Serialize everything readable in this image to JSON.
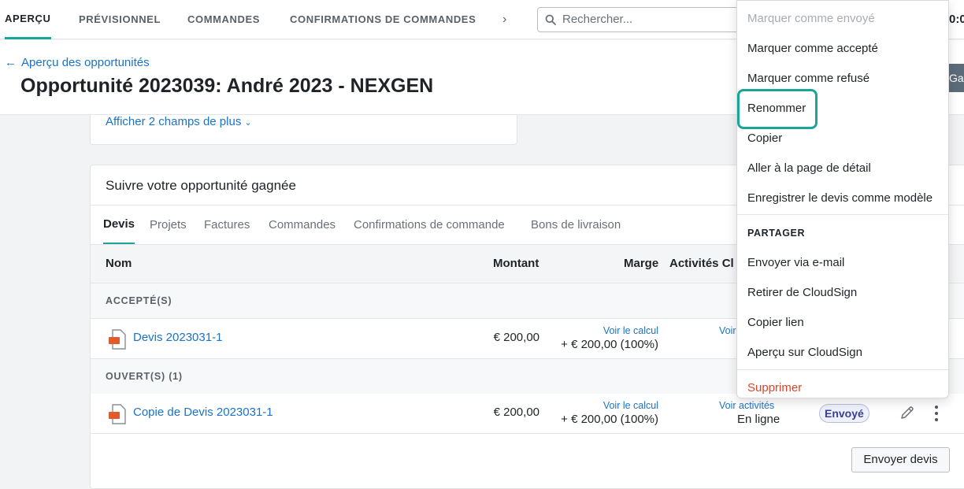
{
  "nav": {
    "tabs": [
      "APERÇU",
      "PRÉVISIONNEL",
      "COMMANDES",
      "CONFIRMATIONS DE COMMANDES"
    ],
    "more_chevron": "›",
    "search_placeholder": "Rechercher...",
    "clock_fragment": "0:0",
    "accent_color": "#1aa59a"
  },
  "header": {
    "back_link": "Aperçu des opportunités",
    "title": "Opportunité 2023039: André 2023 - NEXGEN",
    "right_button": "Ga"
  },
  "details_card": {
    "more_link": "Afficher 2 champs de plus"
  },
  "won_card": {
    "title": "Suivre votre opportunité gagnée",
    "tabs": [
      "Devis",
      "Projets",
      "Factures",
      "Commandes",
      "Confirmations de commande",
      "Bons de livraison"
    ],
    "columns": [
      "Nom",
      "Montant",
      "Marge",
      "Activités Cl"
    ],
    "groups": [
      {
        "label": "ACCEPTÉ(S)",
        "rows": [
          {
            "name": "Devis 2023031-1",
            "amount": "€ 200,00",
            "calc_link": "Voir le calcul",
            "margin": "+ € 200,00 (100%)",
            "activities_link": "Voir",
            "online": "",
            "status": ""
          }
        ]
      },
      {
        "label": "OUVERT(S) (1)",
        "rows": [
          {
            "name": "Copie de Devis 2023031-1",
            "amount": "€ 200,00",
            "calc_link": "Voir le calcul",
            "margin": "+ € 200,00 (100%)",
            "activities_link": "Voir activités",
            "online": "En ligne",
            "status": "Envoyé"
          }
        ]
      }
    ],
    "send_button": "Envoyer devis"
  },
  "menu": {
    "items": [
      {
        "label": "Marquer comme envoyé",
        "state": "disabled"
      },
      {
        "label": "Marquer comme accepté",
        "state": "normal"
      },
      {
        "label": "Marquer comme refusé",
        "state": "normal"
      },
      {
        "label": "Renommer",
        "state": "highlighted"
      },
      {
        "label": "Copier",
        "state": "normal"
      },
      {
        "label": "Aller à la page de détail",
        "state": "normal"
      },
      {
        "label": "Enregistrer le devis comme modèle",
        "state": "normal"
      }
    ],
    "share_section": "PARTAGER",
    "share_items": [
      "Envoyer via e-mail",
      "Retirer de CloudSign",
      "Copier lien",
      "Aperçu sur CloudSign"
    ],
    "danger_item": "Supprimer",
    "danger_color": "#d7462b"
  }
}
